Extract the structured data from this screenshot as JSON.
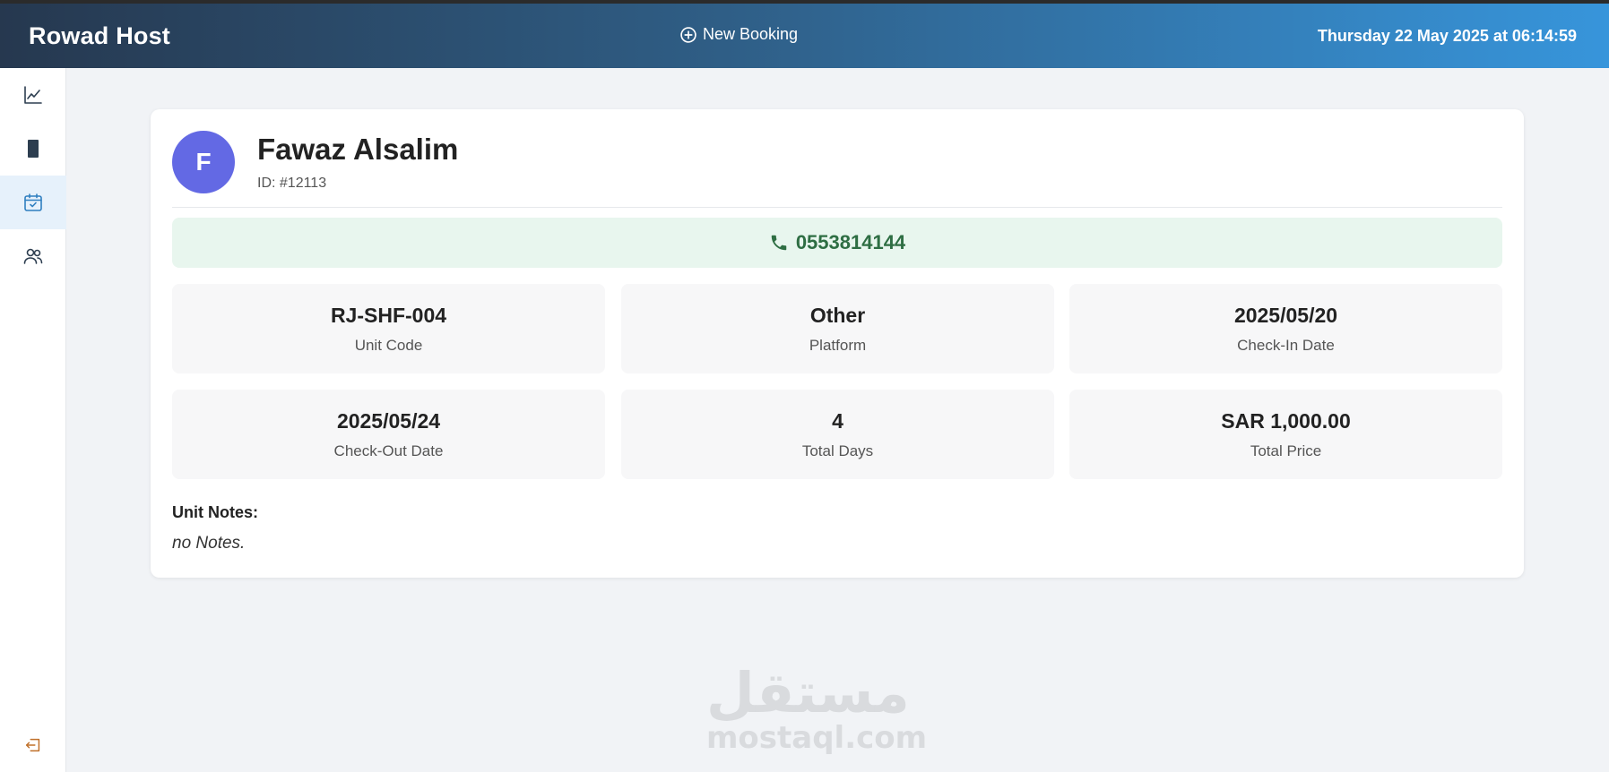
{
  "header": {
    "brand": "Rowad Host",
    "new_booking_label": "New Booking",
    "datetime": "Thursday 22 May 2025 at 06:14:59"
  },
  "sidebar": {
    "items": [
      {
        "icon": "chart-line-icon",
        "active": false
      },
      {
        "icon": "building-icon",
        "active": false
      },
      {
        "icon": "calendar-check-icon",
        "active": true
      },
      {
        "icon": "users-icon",
        "active": false
      }
    ],
    "logout_icon": "logout-icon"
  },
  "guest": {
    "avatar_initial": "F",
    "name": "Fawaz Alsalim",
    "id_text": "ID: #12113",
    "phone": "0553814144"
  },
  "details": [
    {
      "value": "RJ-SHF-004",
      "label": "Unit Code"
    },
    {
      "value": "Other",
      "label": "Platform"
    },
    {
      "value": "2025/05/20",
      "label": "Check-In Date"
    },
    {
      "value": "2025/05/24",
      "label": "Check-Out Date"
    },
    {
      "value": "4",
      "label": "Total Days"
    },
    {
      "value": "SAR 1,000.00",
      "label": "Total Price"
    }
  ],
  "notes": {
    "label": "Unit Notes:",
    "value": "no Notes."
  },
  "watermark": {
    "arabic": "مستقل",
    "latin": "mostaql.com"
  },
  "colors": {
    "header_start": "#26384f",
    "header_end": "#3795db",
    "avatar": "#6369e4",
    "phone_bg": "#e8f6ee",
    "phone_text": "#2e6e43",
    "sidebar_active": "#e6f1fb"
  }
}
